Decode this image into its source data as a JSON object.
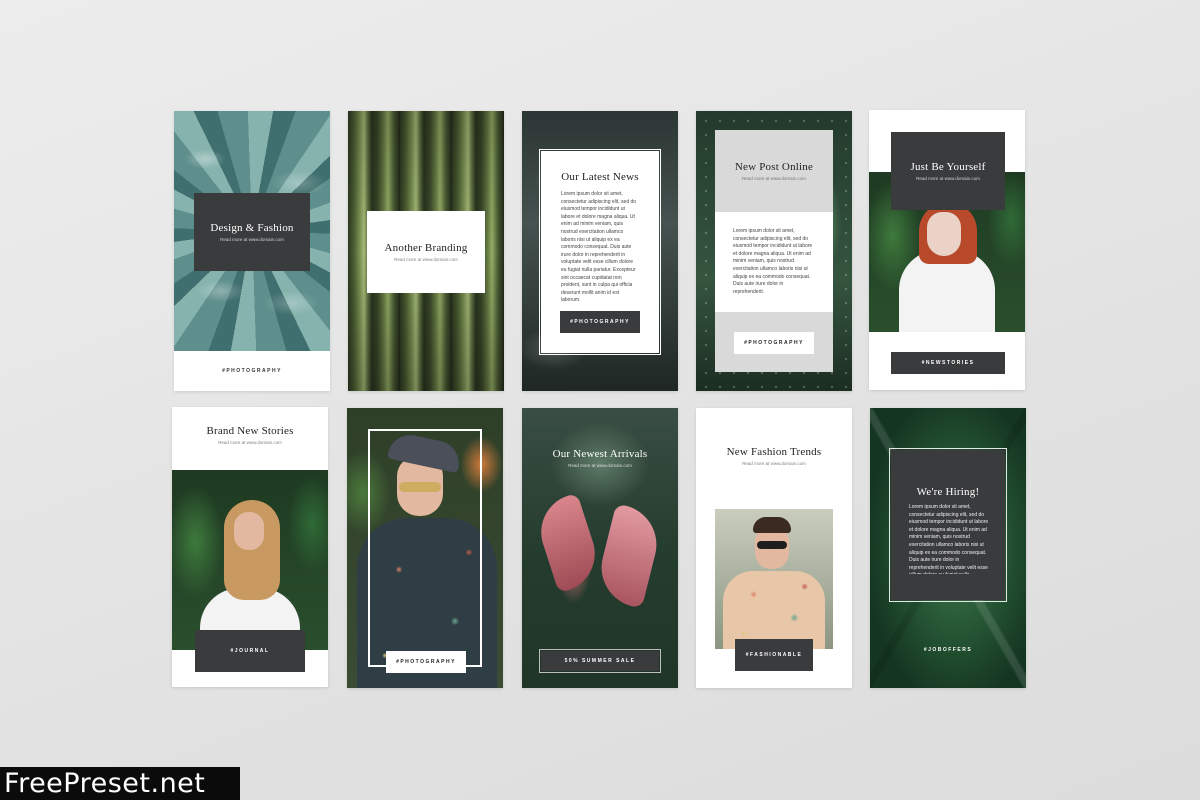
{
  "cards": [
    {
      "title": "Design & Fashion",
      "subtitle": "Read more at www.domain.com",
      "tag": "#PHOTOGRAPHY"
    },
    {
      "title": "Another Branding",
      "subtitle": "Read more at www.domain.com"
    },
    {
      "title": "Our Latest News",
      "body": "Lorem ipsum dolor sit amet, consectetur adipiscing elit, sed do eiusmod tempor incididunt ut labore et dolore magna aliqua. Ut enim ad minim veniam, quis nostrud exercitation ullamco laboris nisi ut aliquip ex ea commodo consequat. Duis aute irure dolor in reprehenderit in voluptate velit esse cillum dolore eu fugiat nulla pariatur. Excepteur sint occaecat cupidatat non proident, sunt in culpa qui officia deserunt mollit anim id est laborum.",
      "tag": "#PHOTOGRAPHY"
    },
    {
      "title": "New Post Online",
      "subtitle": "Read more at www.domain.com",
      "body": "Lorem ipsum dolor sit amet, consectetur adipiscing elit, sed do eiusmod tempor incididunt ut labore et dolore magna aliqua. Ut enim ad minim veniam, quis nostrud exercitation ullamco laboris nisi ut aliquip ex ea commodo consequat. Duis aute irure dolor in reprehenderit.",
      "tag": "#PHOTOGRAPHY"
    },
    {
      "title": "Just Be Yourself",
      "subtitle": "Read more at www.domain.com",
      "tag": "#NEWSTORIES"
    },
    {
      "title": "Brand New Stories",
      "subtitle": "Read more at www.domain.com",
      "tag": "#JOURNAL"
    },
    {
      "tag": "#PHOTOGRAPHY"
    },
    {
      "title": "Our Newest Arrivals",
      "subtitle": "Read more at www.domain.com",
      "tag": "50% SUMMER SALE"
    },
    {
      "title": "New Fashion Trends",
      "subtitle": "Read more at www.domain.com",
      "tag": "#FASHIONABLE"
    },
    {
      "title": "We're Hiring!",
      "body": "Lorem ipsum dolor sit amet, consectetur adipiscing elit, sed do eiusmod tempor incididunt ut labore et dolore magna aliqua. Ut enim ad minim veniam, quis nostrud exercitation ullamco laboris nisi ut aliquip ex ea commodo consequat. Duis aute irure dolor in reprehenderit in voluptate velit esse cillum dolore eu fugiat nulla pariatur.",
      "tag": "#JOBOFFERS"
    }
  ],
  "watermark": "FreePreset.net",
  "colors": {
    "dark_box": "#3a3b3d",
    "background": "#e6e6e6",
    "card": "#ffffff"
  }
}
